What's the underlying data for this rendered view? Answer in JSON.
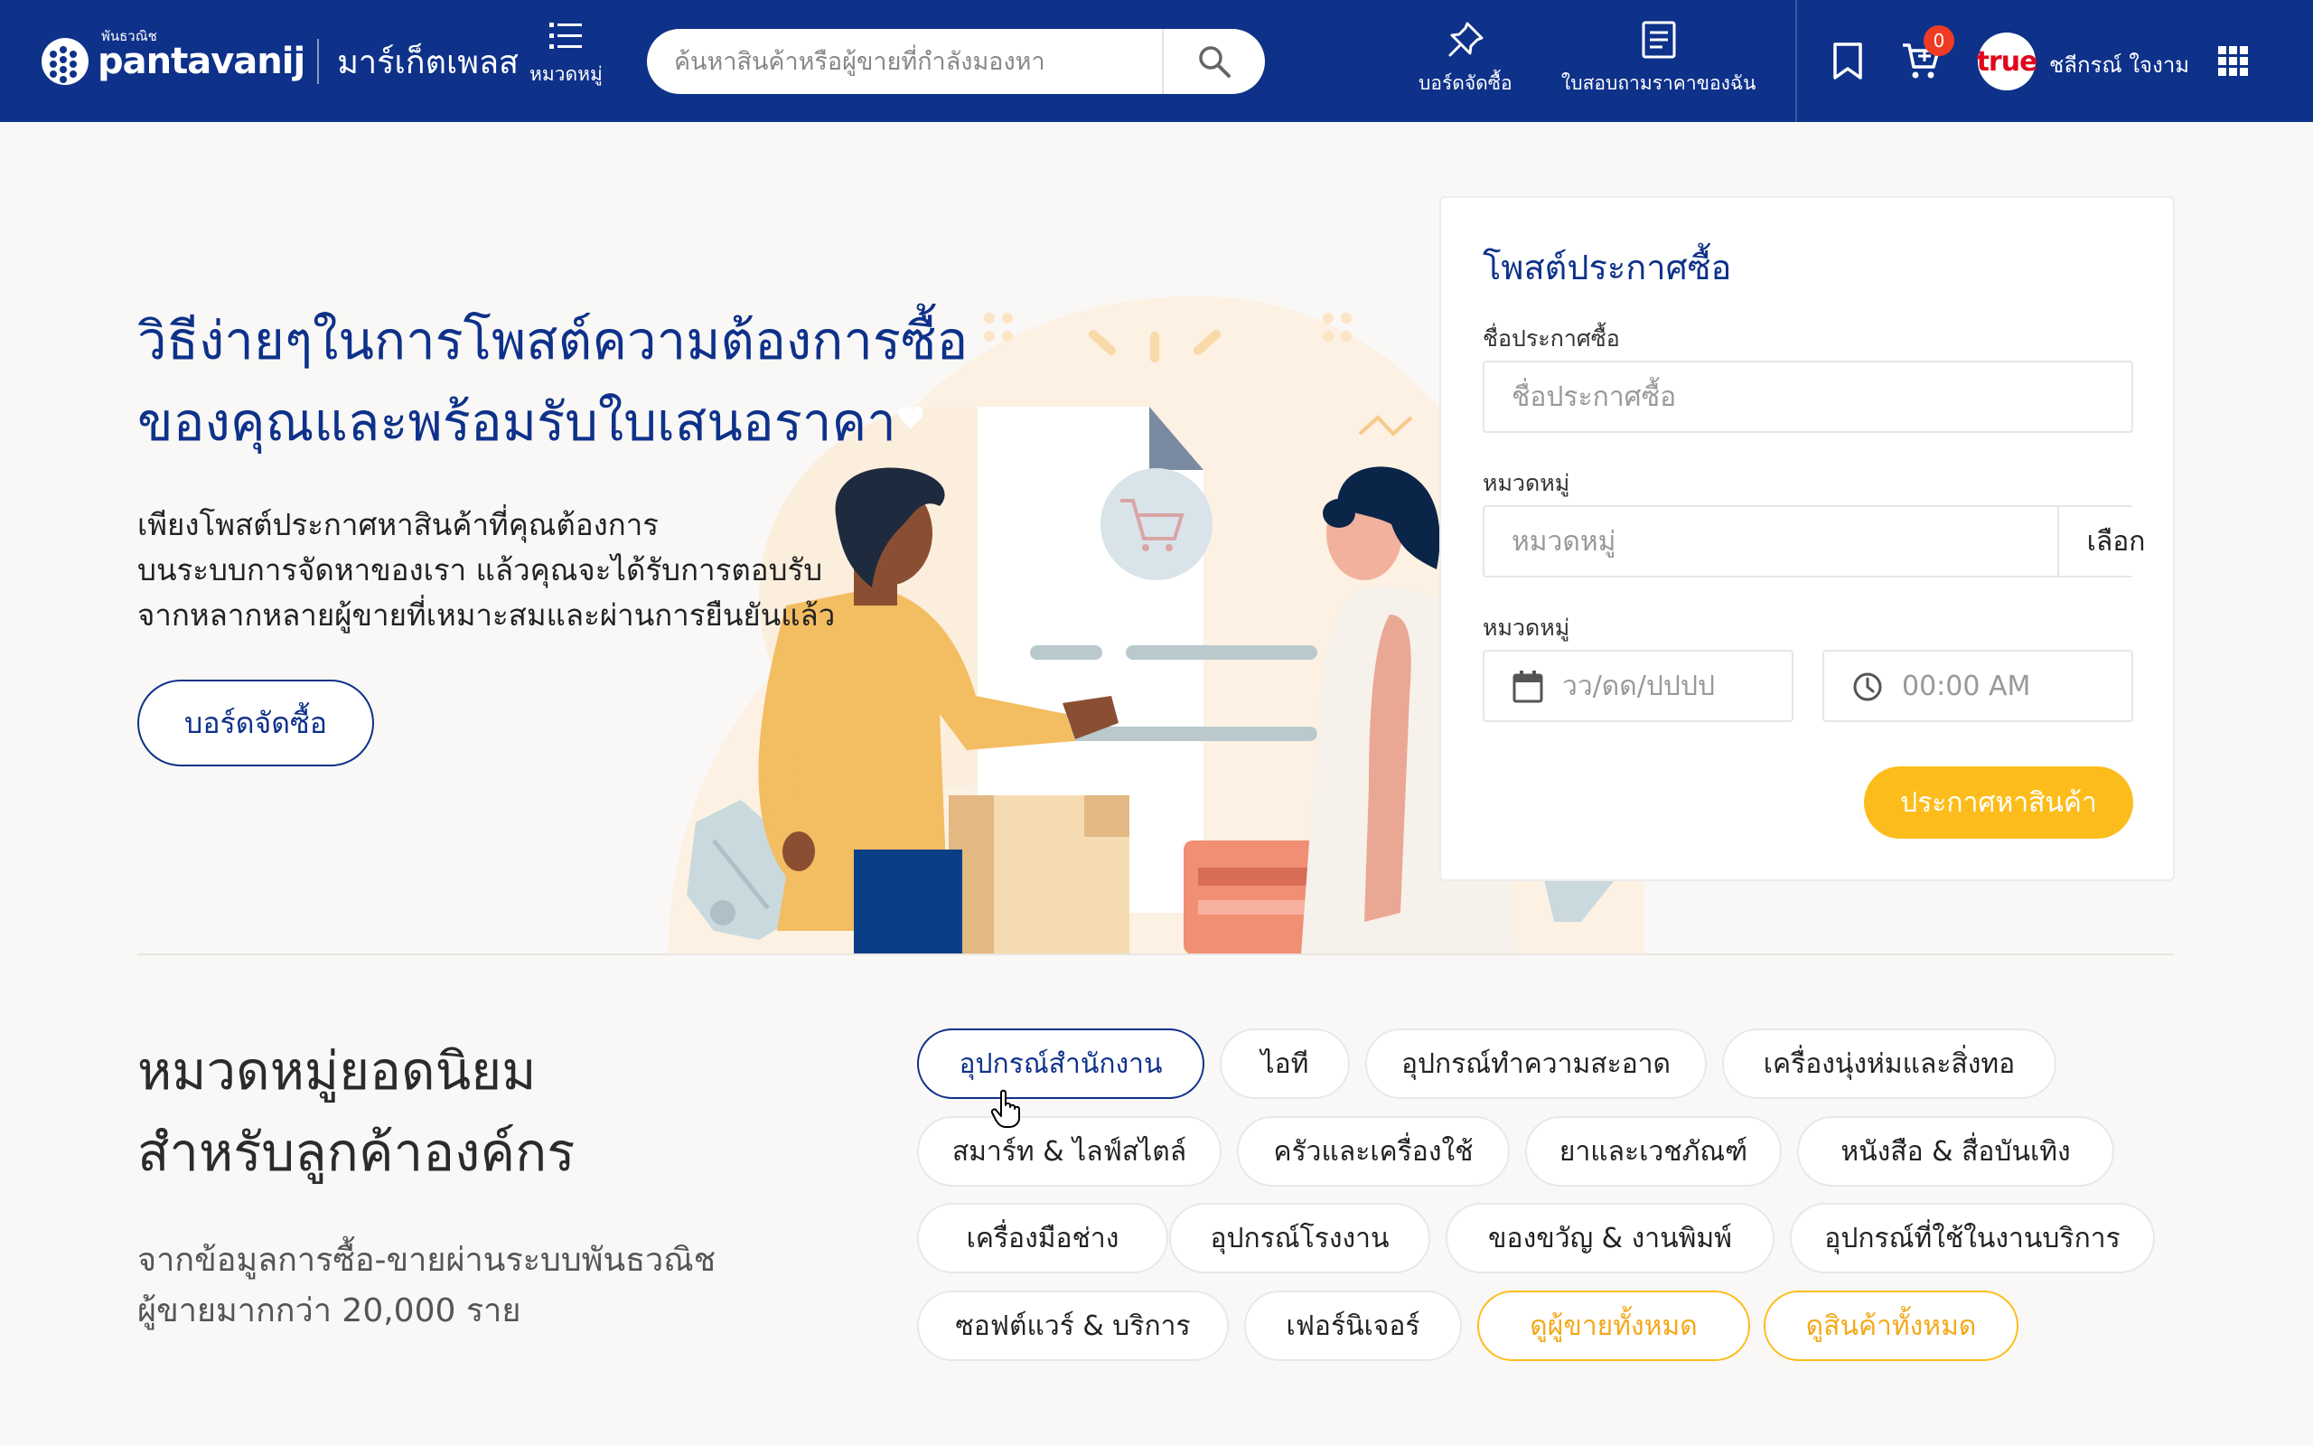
{
  "header": {
    "logo_small": "พันธวณิช",
    "logo_main": "pantavanij",
    "marketplace": "มาร์เก็ตเพลส",
    "categories_label": "หมวดหมู่",
    "search_placeholder": "ค้นหาสินค้าหรือผู้ขายที่กำลังมองหา",
    "procurement_board_label": "บอร์ดจัดซื้อ",
    "my_rfq_label": "ใบสอบถามราคาของฉัน",
    "cart_count": "0",
    "avatar_brand": "true",
    "user_name": "ชลีกรณ์ ใจงาม"
  },
  "hero": {
    "title_line1": "วิธีง่ายๆในการโพสต์ความต้องการซื้อ",
    "title_line2": "ของคุณและพร้อมรับใบเสนอราคา",
    "desc_line1": "เพียงโพสต์ประกาศหาสินค้าที่คุณต้องการ",
    "desc_line2": "บนระบบการจัดหาของเรา แล้วคุณจะได้รับการตอบรับ",
    "desc_line3": "จากหลากหลายผู้ขายที่เหมาะสมและผ่านการยืนยันแล้ว",
    "button": "บอร์ดจัดซื้อ"
  },
  "form": {
    "title": "โพสต์ประกาศซื้อ",
    "name_label": "ชื่อประกาศซื้อ",
    "name_placeholder": "ชื่อประกาศซื้อ",
    "category_label": "หมวดหมู่",
    "category_placeholder": "หมวดหมู่",
    "choose_button": "เลือก",
    "date_label": "หมวดหมู่",
    "date_placeholder": "วว/ดด/ปปปป",
    "time_placeholder": "00:00 AM",
    "submit": "ประกาศหาสินค้า"
  },
  "popular": {
    "title_line1": "หมวดหมู่ยอดนิยม",
    "title_line2": "สำหรับลูกค้าองค์กร",
    "desc_line1": "จากข้อมูลการซื้อ-ขายผ่านระบบพันธวณิช",
    "desc_line2": "ผู้ขายมากกว่า 20,000 ราย",
    "chips": [
      "อุปกรณ์สำนักงาน",
      "ไอที",
      "อุปกรณ์ทำความสะอาด",
      "เครื่องนุ่งห่มและสิ่งทอ",
      "สมาร์ท & ไลฟ์สไตล์",
      "ครัวและเครื่องใช้",
      "ยาและเวชภัณฑ์",
      "หนังสือ & สื่อบันเทิง",
      "เครื่องมือช่าง",
      "อุปกรณ์โรงงาน",
      "ของขวัญ & งานพิมพ์",
      "อุปกรณ์ที่ใช้ในงานบริการ",
      "ซอฟต์แวร์ & บริการ",
      "เฟอร์นิเจอร์",
      "ดูผู้ขายทั้งหมด",
      "ดูสินค้าทั้งหมด"
    ]
  },
  "colors": {
    "brand_blue": "#0e318a",
    "accent_yellow": "#fcbd1c",
    "badge_red": "#ef3b24"
  }
}
